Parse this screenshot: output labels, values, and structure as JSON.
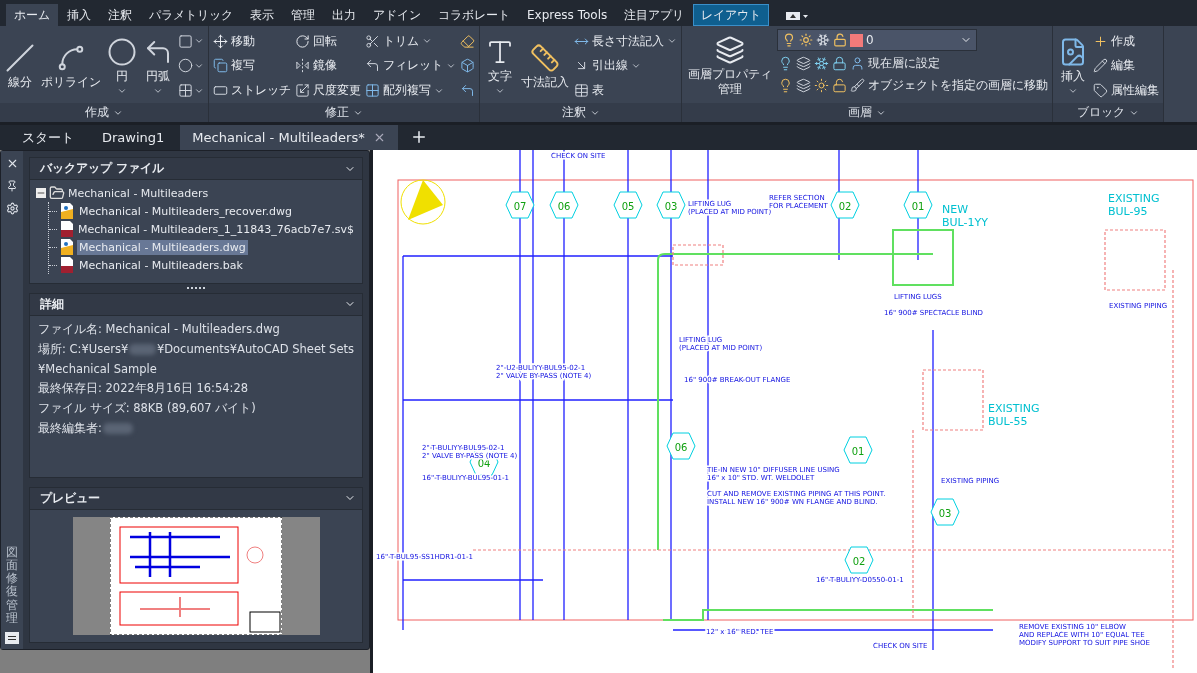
{
  "ribbon_tabs": [
    {
      "label": "ホーム",
      "selected": true,
      "highlighted": false
    },
    {
      "label": "挿入",
      "selected": false,
      "highlighted": false
    },
    {
      "label": "注釈",
      "selected": false,
      "highlighted": false
    },
    {
      "label": "パラメトリック",
      "selected": false,
      "highlighted": false
    },
    {
      "label": "表示",
      "selected": false,
      "highlighted": false
    },
    {
      "label": "管理",
      "selected": false,
      "highlighted": false
    },
    {
      "label": "出力",
      "selected": false,
      "highlighted": false
    },
    {
      "label": "アドイン",
      "selected": false,
      "highlighted": false
    },
    {
      "label": "コラボレート",
      "selected": false,
      "highlighted": false
    },
    {
      "label": "Express Tools",
      "selected": false,
      "highlighted": false
    },
    {
      "label": "注目アプリ",
      "selected": false,
      "highlighted": false
    },
    {
      "label": "レイアウト",
      "selected": false,
      "highlighted": true
    }
  ],
  "panels": [
    {
      "title": "作成",
      "columns": [
        {
          "kind": "tools",
          "tools": [
            {
              "kind": "large",
              "label": "線分",
              "caret": false
            }
          ]
        },
        {
          "kind": "tools",
          "tools": [
            {
              "kind": "large",
              "label": "ポリライン",
              "caret": false
            }
          ]
        },
        {
          "kind": "tools",
          "tools": [
            {
              "kind": "large",
              "label": "円",
              "caret": true
            }
          ]
        },
        {
          "kind": "tools",
          "tools": [
            {
              "kind": "large",
              "label": "円弧",
              "caret": true
            }
          ]
        },
        {
          "kind": "tools",
          "tools": [
            {
              "kind": "icon",
              "caret": true
            },
            {
              "kind": "icon",
              "caret": true
            },
            {
              "kind": "icon",
              "caret": true
            }
          ]
        }
      ]
    },
    {
      "title": "修正",
      "columns": [
        {
          "kind": "tools",
          "tools": [
            {
              "kind": "small",
              "label": "移動",
              "caret": false
            },
            {
              "kind": "small",
              "label": "複写",
              "caret": false
            },
            {
              "kind": "small",
              "label": "ストレッチ",
              "caret": false
            }
          ]
        },
        {
          "kind": "tools",
          "tools": [
            {
              "kind": "small",
              "label": "回転",
              "caret": false
            },
            {
              "kind": "small",
              "label": "鏡像",
              "caret": false
            },
            {
              "kind": "small",
              "label": "尺度変更",
              "caret": false
            }
          ]
        },
        {
          "kind": "tools",
          "tools": [
            {
              "kind": "small",
              "label": "トリム",
              "caret": true
            },
            {
              "kind": "small",
              "label": "フィレット",
              "caret": true
            },
            {
              "kind": "small",
              "label": "配列複写",
              "caret": true
            }
          ]
        },
        {
          "kind": "tools",
          "tools": [
            {
              "kind": "icon",
              "caret": false
            },
            {
              "kind": "icon",
              "caret": false
            },
            {
              "kind": "icon",
              "caret": false
            }
          ]
        }
      ]
    },
    {
      "title": "注釈",
      "columns": [
        {
          "kind": "tools",
          "tools": [
            {
              "kind": "large",
              "label": "文字",
              "caret": true
            }
          ]
        },
        {
          "kind": "tools",
          "tools": [
            {
              "kind": "large",
              "label": "寸法記入",
              "caret": false
            }
          ]
        },
        {
          "kind": "tools",
          "tools": [
            {
              "kind": "small",
              "label": "長さ寸法記入",
              "caret": true
            },
            {
              "kind": "small",
              "label": "引出線",
              "caret": true
            },
            {
              "kind": "small",
              "label": "表",
              "caret": false
            }
          ]
        }
      ]
    },
    {
      "title": "画層",
      "columns": [
        {
          "kind": "tools",
          "tools": [
            {
              "kind": "large",
              "label": "画層プロパティ管理",
              "caret": false
            }
          ]
        },
        {
          "kind": "layer",
          "dropdown": {
            "value": "0",
            "color": "#f27a7a"
          },
          "rows": [
            [
              {
                "kind": "icon",
                "caret": false
              },
              {
                "kind": "icon",
                "caret": false
              },
              {
                "kind": "icon",
                "caret": false
              },
              {
                "kind": "icon",
                "caret": false
              },
              {
                "kind": "small",
                "label": "現在層に設定",
                "caret": false
              }
            ],
            [
              {
                "kind": "icon",
                "caret": false
              },
              {
                "kind": "icon",
                "caret": false
              },
              {
                "kind": "icon",
                "caret": false
              },
              {
                "kind": "icon",
                "caret": false
              },
              {
                "kind": "small",
                "label": "オブジェクトを指定の画層に移動",
                "caret": false
              }
            ]
          ]
        }
      ]
    },
    {
      "title": "ブロック",
      "columns": [
        {
          "kind": "tools",
          "tools": [
            {
              "kind": "large",
              "label": "挿入",
              "caret": true
            }
          ]
        },
        {
          "kind": "tools",
          "tools": [
            {
              "kind": "small",
              "label": "作成",
              "caret": false
            },
            {
              "kind": "small",
              "label": "編集",
              "caret": false
            },
            {
              "kind": "small",
              "label": "属性編集",
              "caret": false
            }
          ]
        }
      ]
    }
  ],
  "document_tabs": [
    {
      "label": "スタート",
      "selected": false
    },
    {
      "label": "Drawing1",
      "selected": false
    },
    {
      "label": "Mechanical - Multileaders*",
      "selected": true
    }
  ],
  "palette": {
    "title": "図面修復管理",
    "backup": {
      "title": "バックアップ ファイル",
      "root": {
        "label": "Mechanical - Multileaders",
        "expanded": true,
        "children": [
          {
            "label": "Mechanical - Multileaders_recover.dwg",
            "kind": "dwg",
            "selected": false
          },
          {
            "label": "Mechanical - Multileaders_1_11843_76acb7e7.sv$",
            "kind": "backup",
            "selected": false
          },
          {
            "label": "Mechanical - Multileaders.dwg",
            "kind": "dwg",
            "selected": true
          },
          {
            "label": "Mechanical - Multileaders.bak",
            "kind": "backup",
            "selected": false
          }
        ]
      }
    },
    "details": {
      "title": "詳細",
      "lines": [
        {
          "kind": "text",
          "text": "ファイル名: Mechanical - Multileaders.dwg"
        },
        {
          "kind": "masked",
          "before": "場所: C:¥Users¥",
          "after": "¥Documents¥AutoCAD Sheet Sets"
        },
        {
          "kind": "text",
          "text": "¥Mechanical Sample"
        },
        {
          "kind": "text",
          "text": "最終保存日: 2022年8月16日  16:54:28"
        },
        {
          "kind": "text",
          "text": "ファイル サイズ: 88KB (89,607 バイト)"
        },
        {
          "kind": "masked",
          "before": "最終編集者:"
        }
      ]
    },
    "preview": {
      "title": "プレビュー"
    }
  },
  "drawing": {
    "labels": [
      {
        "kind": "note",
        "text": "CHECK ON SITE"
      },
      {
        "kind": "note",
        "text": "LIFTING LUG\n(PLACED AT MID POINT)"
      },
      {
        "kind": "note",
        "text": "REFER SECTION\nFOR PLACEMENT"
      },
      {
        "kind": "title",
        "text": "NEW\nBUL-1YY"
      },
      {
        "kind": "title",
        "text": "EXISTING\nBUL-95"
      },
      {
        "kind": "note",
        "text": "LIFTING LUGS"
      },
      {
        "kind": "note",
        "text": "16\" 900# SPECTACLE BLIND"
      },
      {
        "kind": "note",
        "text": "EXISTING PIPING"
      },
      {
        "kind": "note",
        "text": "LIFTING LUG\n(PLACED AT MID POINT)"
      },
      {
        "kind": "note",
        "text": "16\" 900# BREAK-OUT FLANGE"
      },
      {
        "kind": "note",
        "text": "2\"-U2-BULIYY-BUL95-02-1\n2\" VALVE BY-PASS (NOTE 4)"
      },
      {
        "kind": "title",
        "text": "EXISTING\nBUL-55"
      },
      {
        "kind": "note",
        "text": "TIE-IN NEW 10\" DIFFUSER LINE USING\n16\" x 10\" STD. WT. WELDOLET"
      },
      {
        "kind": "note",
        "text": "CUT AND REMOVE EXISTING PIPING AT THIS POINT.\nINSTALL NEW 16\" 900# WN FLANGE AND BLIND."
      },
      {
        "kind": "note",
        "text": "EXISTING PIPING"
      },
      {
        "kind": "note",
        "text": "16\"-T-BUL95-SS1HDR1-01-1"
      },
      {
        "kind": "note",
        "text": "12\" x 16\" RED. TEE"
      },
      {
        "kind": "note",
        "text": "16\"-T-BULIYY-D0550-01-1"
      },
      {
        "kind": "note",
        "text": "REMOVE EXISTING 10\" ELBOW\nAND REPLACE WITH 10\" EQUAL TEE\nMODIFY SUPPORT TO SUIT PIPE SHOE"
      },
      {
        "kind": "note",
        "text": "CHECK ON SITE"
      },
      {
        "kind": "note",
        "text": "2\"-T-BULIYY-BUL95-02-1\n2\" VALVE BY-PASS (NOTE 4)"
      },
      {
        "kind": "note",
        "text": "16\"-T-BULIYY-BUL95-01-1"
      }
    ],
    "tags": [
      {
        "num": "07"
      },
      {
        "num": "06"
      },
      {
        "num": "05"
      },
      {
        "num": "03"
      },
      {
        "num": "02"
      },
      {
        "num": "01"
      },
      {
        "num": "04"
      },
      {
        "num": "06"
      },
      {
        "num": "01"
      },
      {
        "num": "03"
      },
      {
        "num": "02"
      }
    ]
  }
}
